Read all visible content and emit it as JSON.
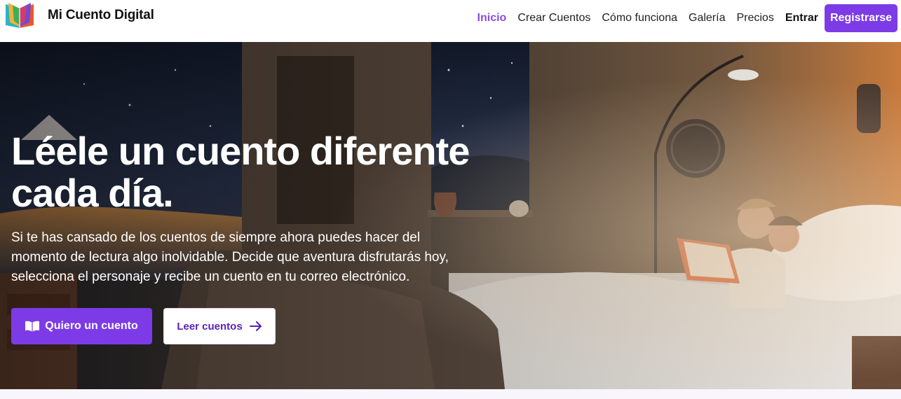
{
  "header": {
    "brand": "Mi Cuento Digital",
    "nav": [
      {
        "label": "Inicio",
        "active": true
      },
      {
        "label": "Crear Cuentos"
      },
      {
        "label": "Cómo funciona"
      },
      {
        "label": "Galería"
      },
      {
        "label": "Precios"
      }
    ],
    "login_label": "Entrar",
    "register_label": "Registrarse"
  },
  "hero": {
    "title": "Léele un cuento diferente cada día.",
    "text": "Si te has cansado de los cuentos de siempre ahora puedes hacer del momento de lectura algo inolvidable. Decide que aventura disfrutarás hoy, selecciona el personaje y recibe un cuento en tu correo electrónico.",
    "primary_cta": "Quiero un cuento",
    "secondary_cta": "Leer cuentos"
  },
  "colors": {
    "accent": "#7c3be6",
    "accent_text": "#8a4ce6",
    "secondary_text": "#5b21b6"
  },
  "icons": {
    "logo": "book-logo-icon",
    "primary_cta": "open-book-icon",
    "secondary_cta": "arrow-right-icon"
  }
}
